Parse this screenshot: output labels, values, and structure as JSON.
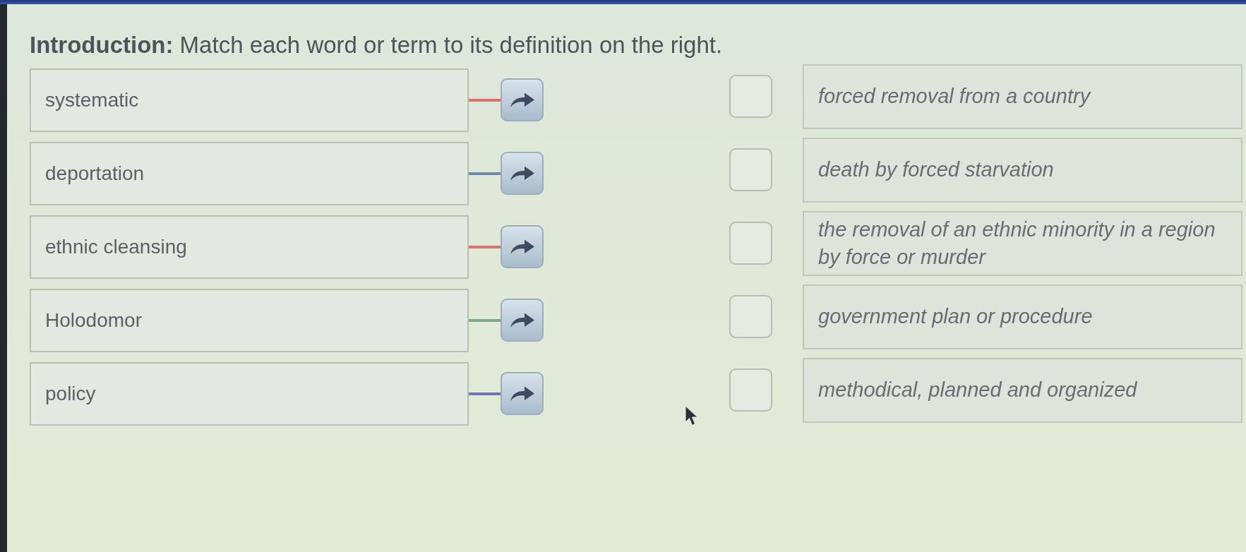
{
  "instruction": "**Introduction:** Match each word or term to its definition on the right.",
  "terms": [
    {
      "text": "systematic",
      "color": "#d8706a"
    },
    {
      "text": "deportation",
      "color": "#6f8aa6"
    },
    {
      "text": "ethnic cleansing",
      "color": "#d8756c"
    },
    {
      "text": "Holodomor",
      "color": "#80a88c"
    },
    {
      "text": "policy",
      "color": "#7276b0"
    }
  ],
  "definitions": [
    {
      "text": "forced removal from a country",
      "checked": false
    },
    {
      "text": "death by forced starvation",
      "checked": false
    },
    {
      "text": "the removal of an ethnic minority in a region by force or murder",
      "checked": false
    },
    {
      "text": "government plan or procedure",
      "checked": false
    },
    {
      "text": "methodical, planned and organized",
      "checked": false
    }
  ]
}
